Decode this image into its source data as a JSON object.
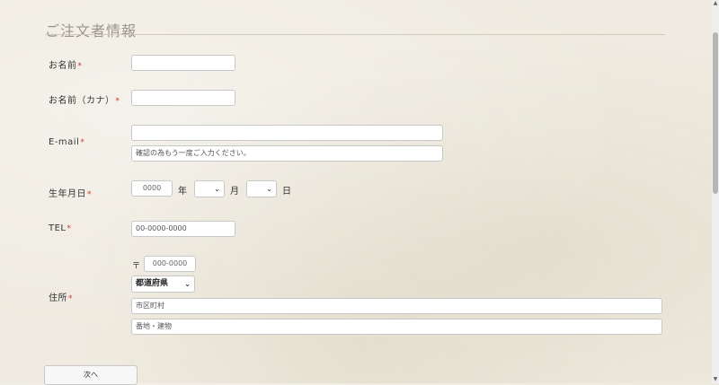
{
  "section": {
    "title": "ご注文者情報"
  },
  "required_mark": "*",
  "fields": {
    "name": {
      "label": "お名前",
      "value": ""
    },
    "kana": {
      "label": "お名前（カナ）",
      "value": ""
    },
    "email": {
      "label": "E-mail",
      "value": "",
      "confirm_placeholder": "確認の為もう一度ご入力ください。"
    },
    "birthday": {
      "label": "生年月日",
      "year_placeholder": "0000",
      "year_unit": "年",
      "month_value": "",
      "month_unit": "月",
      "day_value": "",
      "day_unit": "日"
    },
    "tel": {
      "label": "TEL",
      "placeholder": "00-0000-0000"
    },
    "address": {
      "label": "住所",
      "postal_mark": "〒",
      "postal_placeholder": "000-0000",
      "prefecture_selected": "都道府県",
      "city_placeholder": "市区町村",
      "street_placeholder": "番地・建物"
    }
  },
  "buttons": {
    "next_label": "次へ"
  },
  "icons": {
    "select_arrow": "chevron-down-icon"
  },
  "colors": {
    "required": "#d0312d",
    "background": "#efebe0"
  }
}
